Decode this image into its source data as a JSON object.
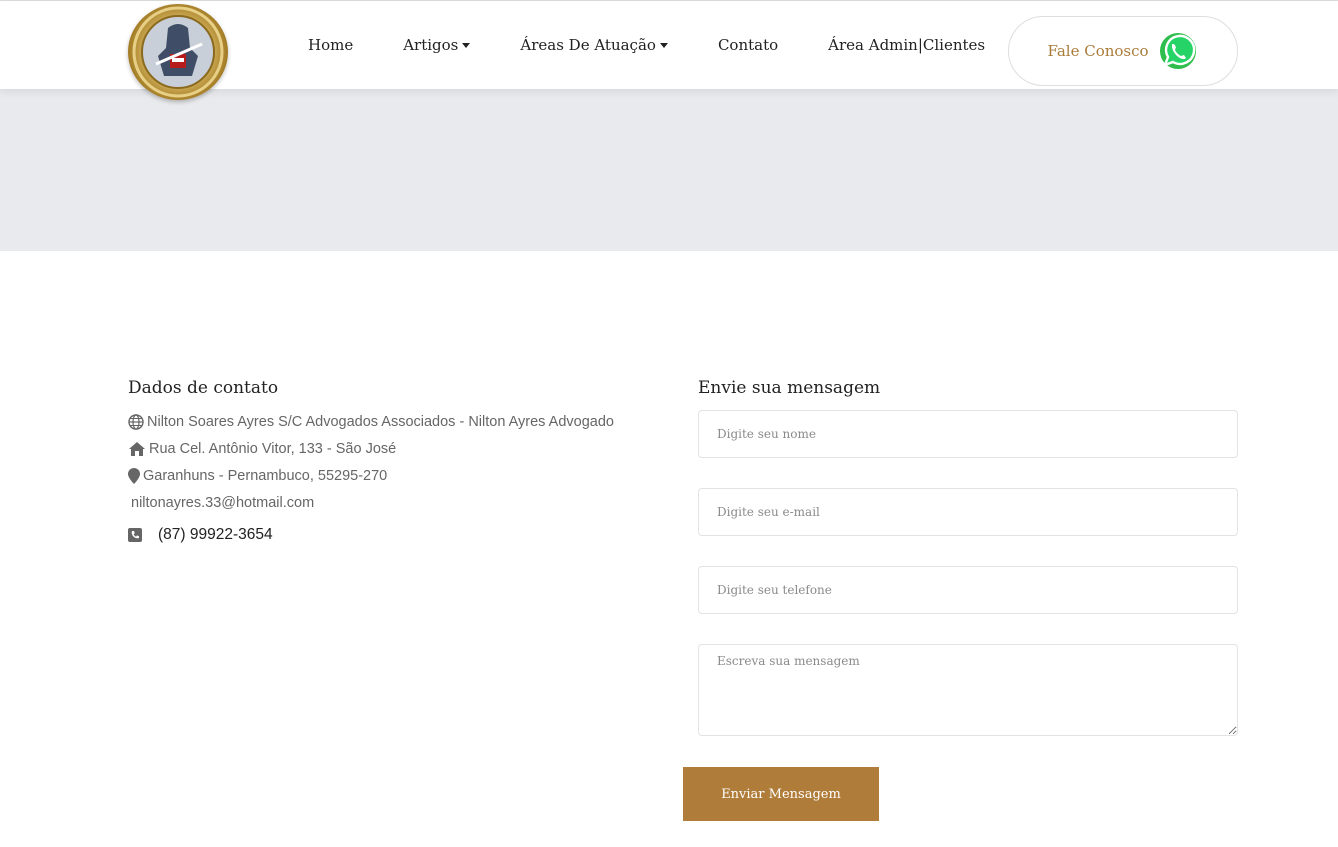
{
  "header": {
    "nav": [
      {
        "label": "Home",
        "has_dropdown": false
      },
      {
        "label": "Artigos",
        "has_dropdown": true
      },
      {
        "label": "Áreas De Atuação",
        "has_dropdown": true
      },
      {
        "label": "Contato",
        "has_dropdown": false
      },
      {
        "label": "Área Admin|Clientes",
        "has_dropdown": false
      }
    ],
    "cta_label": "Fale Conosco",
    "cta_icon": "whatsapp-icon"
  },
  "contact": {
    "title": "Dados de contato",
    "company": "Nilton Soares Ayres S/C Advogados Associados - Nilton Ayres Advogado",
    "street": "Rua Cel. Antônio Vitor, 133 - São José",
    "city": "Garanhuns - Pernambuco, 55295-270",
    "email": "niltonayres.33@hotmail.com",
    "phone": "(87) 99922-3654"
  },
  "form": {
    "title": "Envie sua mensagem",
    "name_placeholder": "Digite seu nome",
    "email_placeholder": "Digite seu e-mail",
    "phone_placeholder": "Digite seu telefone",
    "message_placeholder": "Escreva sua mensagem",
    "submit_label": "Enviar Mensagem"
  },
  "colors": {
    "accent": "#b07c3a",
    "banner": "#e9eaed",
    "whatsapp": "#25d366"
  }
}
